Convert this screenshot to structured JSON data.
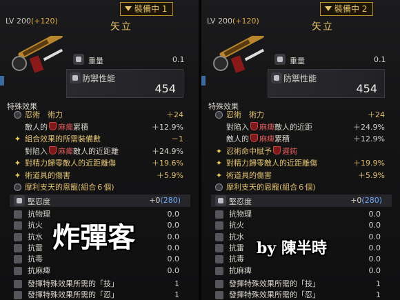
{
  "left": {
    "tab": "裝備中 1",
    "level": "LV 200",
    "level_plus": "(+120)",
    "name": "矢立",
    "weight_label": "重量",
    "weight_value": "0.1",
    "defense_label": "防禦性能",
    "defense_value": "454",
    "special_title": "特殊效果",
    "effects": [
      {
        "icon": "gear",
        "html_a": "忍術　術力",
        "a": "忍術　術力",
        "val": "＋24",
        "white": false
      },
      {
        "icon": "none",
        "a": "敵人的",
        "red": "麻痺",
        "b": "累積",
        "val": "＋12.9%",
        "white": true
      },
      {
        "icon": "star",
        "a": "組合效果的所需裝備數",
        "val": "－1",
        "white": false
      },
      {
        "icon": "none",
        "a": "對陷入",
        "red": "麻痺",
        "b": "敵人的近距離",
        "val": "＋24.9%",
        "white": true
      },
      {
        "icon": "star",
        "a": "對精力歸零敵人的近距離傷",
        "val": "＋19.6%",
        "white": false
      },
      {
        "icon": "star",
        "a": "術道具的傷害",
        "val": "＋5.9%",
        "white": false
      },
      {
        "icon": "gear",
        "a": "摩利支天的恩寵(組合６個)",
        "val": "",
        "white": false
      }
    ],
    "toughness_label": "堅忍度",
    "toughness_value": "+0",
    "toughness_extra": "(280)",
    "resists": [
      {
        "label": "抗物理",
        "value": "0.0"
      },
      {
        "label": "抗火",
        "value": "0.0"
      },
      {
        "label": "抗水",
        "value": "0.0"
      },
      {
        "label": "抗雷",
        "value": "0.0"
      },
      {
        "label": "抗毒",
        "value": "0.0"
      },
      {
        "label": "抗麻痺",
        "value": "0.0"
      }
    ],
    "req": [
      {
        "label": "發揮特殊效果所需的「技」",
        "value": "1"
      },
      {
        "label": "發揮特殊效果所需的「忍」",
        "value": "1"
      }
    ]
  },
  "right": {
    "tab": "裝備中 2",
    "level": "LV 200",
    "level_plus": "(+120)",
    "name": "矢立",
    "weight_label": "重量",
    "weight_value": "0.1",
    "defense_label": "防禦性能",
    "defense_value": "454",
    "special_title": "特殊效果",
    "effects": [
      {
        "icon": "gear",
        "a": "忍術　術力",
        "val": "＋24",
        "white": false
      },
      {
        "icon": "none",
        "a": "對陷入",
        "red": "麻痺",
        "b": "敵人的近距",
        "val": "＋24.9%",
        "white": true
      },
      {
        "icon": "none",
        "a": "敵人的",
        "red": "麻痺",
        "b": "累積",
        "val": "＋12.9%",
        "white": true
      },
      {
        "icon": "star",
        "a": "忍術命中賦予",
        "red": "遲鈍",
        "b": "",
        "val": "",
        "white": false
      },
      {
        "icon": "star",
        "a": "對精力歸零敵人的近距離傷",
        "val": "＋19.9%",
        "white": false
      },
      {
        "icon": "star",
        "a": "術道具的傷害",
        "val": "＋5.9%",
        "white": false
      },
      {
        "icon": "gear",
        "a": "摩利支天的恩寵(組合６個)",
        "val": "",
        "white": false
      }
    ],
    "toughness_label": "堅忍度",
    "toughness_value": "+0",
    "toughness_extra": "(280)",
    "resists": [
      {
        "label": "抗物理",
        "value": "0.0"
      },
      {
        "label": "抗火",
        "value": "0.0"
      },
      {
        "label": "抗水",
        "value": "0.0"
      },
      {
        "label": "抗雷",
        "value": "0.0"
      },
      {
        "label": "抗毒",
        "value": "0.0"
      },
      {
        "label": "抗麻痺",
        "value": "0.0"
      }
    ],
    "req": [
      {
        "label": "發揮特殊效果所需的「技」",
        "value": "1"
      },
      {
        "label": "發揮特殊效果所需的「忍」",
        "value": "1"
      }
    ]
  },
  "overlay_title": "炸彈客",
  "overlay_author": "by 陳半時"
}
